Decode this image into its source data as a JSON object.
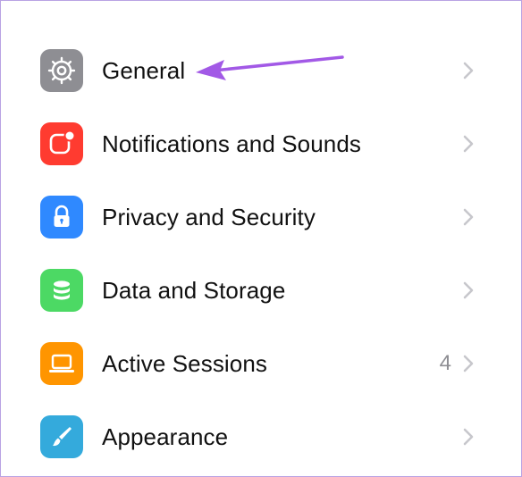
{
  "colors": {
    "general": "#8e8e93",
    "notifications": "#ff3b30",
    "privacy": "#2f89ff",
    "data": "#4cd964",
    "sessions": "#ff9500",
    "appearance": "#34aadc",
    "annotation_arrow": "#a259e6",
    "frame_border": "#b9a3e3"
  },
  "settings": {
    "items": [
      {
        "label": "General",
        "icon": "gear-icon",
        "count": ""
      },
      {
        "label": "Notifications and Sounds",
        "icon": "notification-badge-icon",
        "count": ""
      },
      {
        "label": "Privacy and Security",
        "icon": "lock-icon",
        "count": ""
      },
      {
        "label": "Data and Storage",
        "icon": "database-icon",
        "count": ""
      },
      {
        "label": "Active Sessions",
        "icon": "laptop-icon",
        "count": "4"
      },
      {
        "label": "Appearance",
        "icon": "brush-icon",
        "count": ""
      }
    ]
  }
}
